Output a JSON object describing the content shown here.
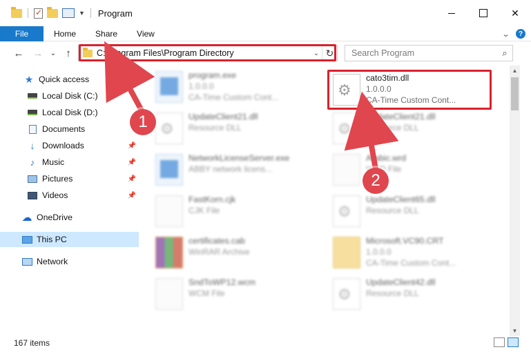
{
  "window": {
    "title": "Program"
  },
  "ribbon": {
    "tabs": [
      "File",
      "Home",
      "Share",
      "View"
    ],
    "help": "?"
  },
  "nav": {
    "address": "C:\\Program Files\\Program Directory",
    "search_placeholder": "Search Program"
  },
  "sidebar": {
    "items": [
      {
        "label": "Quick access",
        "icon": "star-icon"
      },
      {
        "label": "Local Disk (C:)",
        "icon": "drive-icon"
      },
      {
        "label": "Local Disk (D:)",
        "icon": "drive-icon"
      },
      {
        "label": "Documents",
        "icon": "documents-icon"
      },
      {
        "label": "Downloads",
        "icon": "downloads-icon"
      },
      {
        "label": "Music",
        "icon": "music-icon"
      },
      {
        "label": "Pictures",
        "icon": "pictures-icon"
      },
      {
        "label": "Videos",
        "icon": "videos-icon"
      },
      {
        "label": "OneDrive",
        "icon": "cloud-icon"
      },
      {
        "label": "This PC",
        "icon": "computer-icon"
      },
      {
        "label": "Network",
        "icon": "network-icon"
      }
    ]
  },
  "files": [
    {
      "name": "program.exe",
      "line2": "1.0.0.0",
      "line3": "CA-Time Custom Cont..."
    },
    {
      "name": "cato3tim.dll",
      "line2": "1.0.0.0",
      "line3": "CA-Time Custom Cont..."
    },
    {
      "name": "UpdateClient21.dll",
      "line2": "Resource DLL",
      "line3": ""
    },
    {
      "name": "UpdateClient21.dll",
      "line2": "Resource DLL",
      "line3": ""
    },
    {
      "name": "NetworkLicenseServer.exe",
      "line2": "ABBY network licens...",
      "line3": ""
    },
    {
      "name": "Arabic.wrd",
      "line2": "WRD File",
      "line3": ""
    },
    {
      "name": "FastKorn.cjk",
      "line2": "CJK File",
      "line3": ""
    },
    {
      "name": "UpdateClient65.dll",
      "line2": "Resource DLL",
      "line3": ""
    },
    {
      "name": "certificates.cab",
      "line2": "WinRAR Archive",
      "line3": ""
    },
    {
      "name": "Microsoft.VC90.CRT",
      "line2": "1.0.0.0",
      "line3": "CA-Time Custom Cont..."
    },
    {
      "name": "SndToWP12.wcm",
      "line2": "WCM File",
      "line3": ""
    },
    {
      "name": "UpdateClient42.dll",
      "line2": "Resource DLL",
      "line3": ""
    }
  ],
  "status": {
    "item_count": "167 items"
  },
  "annotations": {
    "callout1": "1",
    "callout2": "2",
    "highlight_color": "#d9212c",
    "callout_color": "#e0464e"
  }
}
